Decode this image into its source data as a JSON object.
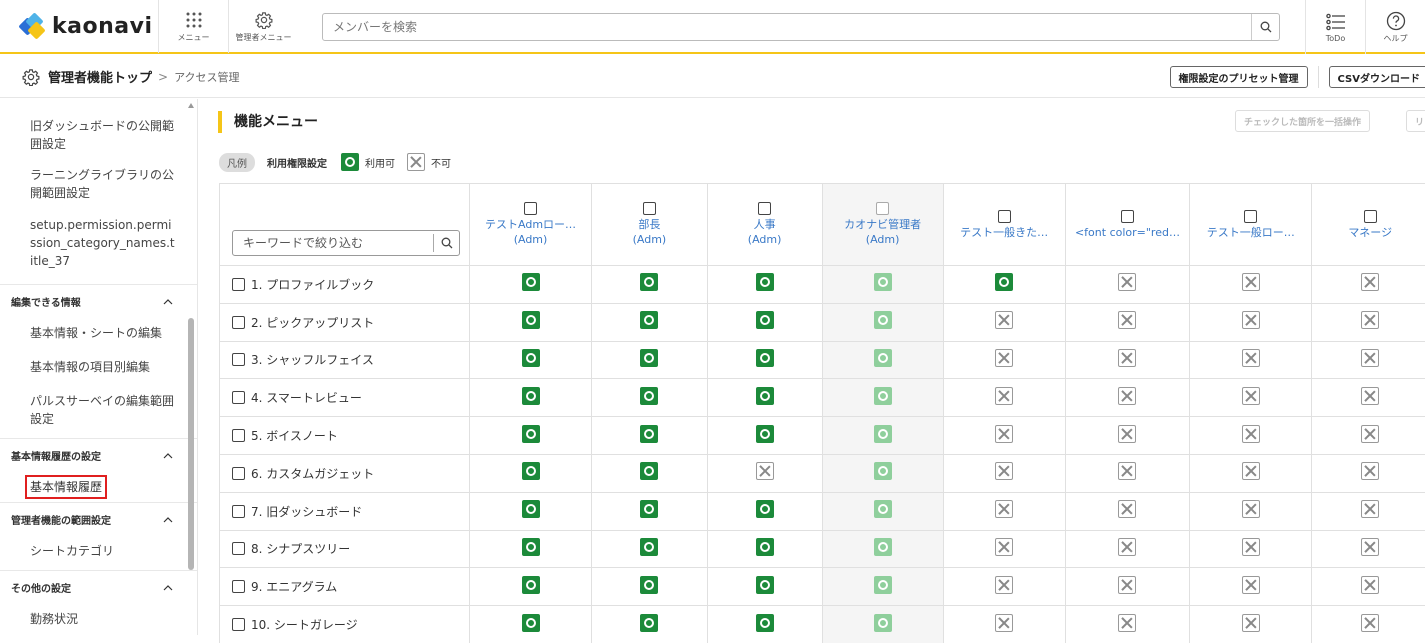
{
  "header": {
    "brand": "kaonavi",
    "menu_label": "メニュー",
    "admin_menu_label": "管理者メニュー",
    "search_placeholder": "メンバーを検索",
    "todo_label": "ToDo",
    "help_label": "ヘルプ"
  },
  "breadcrumb": {
    "title": "管理者機能トップ",
    "separator": ">",
    "current": "アクセス管理",
    "preset_button": "権限設定のプリセット管理",
    "csv_button": "CSVダウンロード"
  },
  "sidebar": {
    "top_items": [
      "旧ダッシュボードの公開範囲設定",
      "ラーニングライブラリの公開範囲設定",
      "setup.permission.permission_category_names.title_37"
    ],
    "sections": [
      {
        "title": "編集できる情報",
        "items": [
          "基本情報・シートの編集",
          "基本情報の項目別編集",
          "パルスサーベイの編集範囲設定"
        ]
      },
      {
        "title": "基本情報履歴の設定",
        "active": "基本情報履歴"
      },
      {
        "title": "管理者機能の範囲設定",
        "items": [
          "シートカテゴリ"
        ]
      },
      {
        "title": "その他の設定",
        "items": [
          "勤務状況"
        ]
      }
    ]
  },
  "main": {
    "title": "機能メニュー",
    "bulk_button": "チェックした箇所を一括操作",
    "extra_button": "リ",
    "legend": {
      "tag": "凡例",
      "label": "利用権限設定",
      "allowed": "利用可",
      "denied": "不可"
    },
    "filter_placeholder": "キーワードで絞り込む"
  },
  "table": {
    "columns": [
      {
        "name": "テストAdmロー…",
        "role": "(Adm)"
      },
      {
        "name": "部長",
        "role": "(Adm)"
      },
      {
        "name": "人事",
        "role": "(Adm)"
      },
      {
        "name": "カオナビ管理者",
        "role": "(Adm)"
      },
      {
        "name": "テスト一般きた…",
        "role": ""
      },
      {
        "name": "<font color=\"red…",
        "role": ""
      },
      {
        "name": "テスト一般ロー…",
        "role": ""
      },
      {
        "name": "マネージ",
        "role": ""
      }
    ],
    "rows": [
      {
        "label": "1. プロファイルブック",
        "cells": [
          "ok",
          "ok",
          "ok",
          "ok",
          "ok",
          "ng",
          "ng",
          "ng"
        ]
      },
      {
        "label": "2. ピックアップリスト",
        "cells": [
          "ok",
          "ok",
          "ok",
          "ok",
          "ng",
          "ng",
          "ng",
          "ng"
        ]
      },
      {
        "label": "3. シャッフルフェイス",
        "cells": [
          "ok",
          "ok",
          "ok",
          "ok",
          "ng",
          "ng",
          "ng",
          "ng"
        ]
      },
      {
        "label": "4. スマートレビュー",
        "cells": [
          "ok",
          "ok",
          "ok",
          "ok",
          "ng",
          "ng",
          "ng",
          "ng"
        ]
      },
      {
        "label": "5. ボイスノート",
        "cells": [
          "ok",
          "ok",
          "ok",
          "ok",
          "ng",
          "ng",
          "ng",
          "ng"
        ]
      },
      {
        "label": "6. カスタムガジェット",
        "cells": [
          "ok",
          "ok",
          "ng",
          "ok",
          "ng",
          "ng",
          "ng",
          "ng"
        ]
      },
      {
        "label": "7. 旧ダッシュボード",
        "cells": [
          "ok",
          "ok",
          "ok",
          "ok",
          "ng",
          "ng",
          "ng",
          "ng"
        ]
      },
      {
        "label": "8. シナプスツリー",
        "cells": [
          "ok",
          "ok",
          "ok",
          "ok",
          "ng",
          "ng",
          "ng",
          "ng"
        ]
      },
      {
        "label": "9. エニアグラム",
        "cells": [
          "ok",
          "ok",
          "ok",
          "ok",
          "ng",
          "ng",
          "ng",
          "ng"
        ]
      },
      {
        "label": "10. シートガレージ",
        "cells": [
          "ok",
          "ok",
          "ok",
          "ok",
          "ng",
          "ng",
          "ng",
          "ng"
        ]
      }
    ]
  },
  "colors": {
    "accent": "#f5c518",
    "allowed": "#1c8a3a",
    "link": "#3a79c7",
    "active_border": "#e01f1f"
  }
}
